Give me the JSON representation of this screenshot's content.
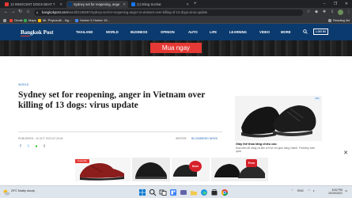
{
  "browser": {
    "tabs": [
      {
        "label": "13 INNOCENT DOGS BEAT T",
        "favicon_color": "#e53935",
        "active": false
      },
      {
        "label": "Sydney set for reopening, ange",
        "favicon_color": "#0b3a6e",
        "active": true
      },
      {
        "label": "(1) Đăng Sochat",
        "favicon_color": "#1877f2",
        "active": false
      }
    ],
    "url_domain": "bangkokpost.com",
    "url_path": "/world/2195567/sydney-set-for-reopening-anger-in-vietnam-over-killing-of-13-dogs-virus-update",
    "bookmarks": [
      {
        "label": "Gmail",
        "color": "#ea4335"
      },
      {
        "label": "Maps",
        "color": "#34a853"
      },
      {
        "label": "Mr. Phylozoth - Ng...",
        "color": "#fbbc04"
      },
      {
        "label": "Hunter X Hunter 15...",
        "color": "#4285f4"
      }
    ],
    "reading_list_label": "Reading list",
    "icons": {
      "back": "arrow-left-icon",
      "forward": "arrow-right-icon",
      "reload": "reload-icon",
      "home": "home-icon",
      "star": "star-icon",
      "extensions": "puzzle-icon",
      "menu": "kebab-menu-icon"
    }
  },
  "site": {
    "logo": "Bangkok Post",
    "nav": [
      "THAILAND",
      "WORLD",
      "BUSINESS",
      "OPINION",
      "AUTO",
      "LIFE",
      "LEARNING",
      "VIDEO",
      "MORE"
    ],
    "login_label": "LOG IN",
    "brand_color": "#0b3a6e"
  },
  "top_ad": {
    "cta": "Mua ngay",
    "cta_color": "#e53935"
  },
  "article": {
    "section": "WORLD",
    "headline": "Sydney set for reopening, anger in Vietnam over killing of 13 dogs: virus update",
    "published": "PUBLISHED : 10 OCT 2021 AT 20:40",
    "writer_label": "WRITER:",
    "writer": "BLOOMBERG NEWS"
  },
  "side_ad": {
    "title": "Giày thể thao tăng chiều cao",
    "description": "Mua sắm dễ dàng và tiện lợi hơi với giao hàng nhanh. Freeship toàn quốc",
    "adchoices": "Ads"
  },
  "bottom_ad": {
    "promo_label": "Freeship toàn quốc",
    "badge_label": "6cm",
    "badge2_label": "Free"
  },
  "taskbar": {
    "weather_temp": "29°C",
    "weather_desc": "Mostly cloudy",
    "language": "ENG",
    "time": "8:52 PM",
    "date": "10/10/2021"
  }
}
